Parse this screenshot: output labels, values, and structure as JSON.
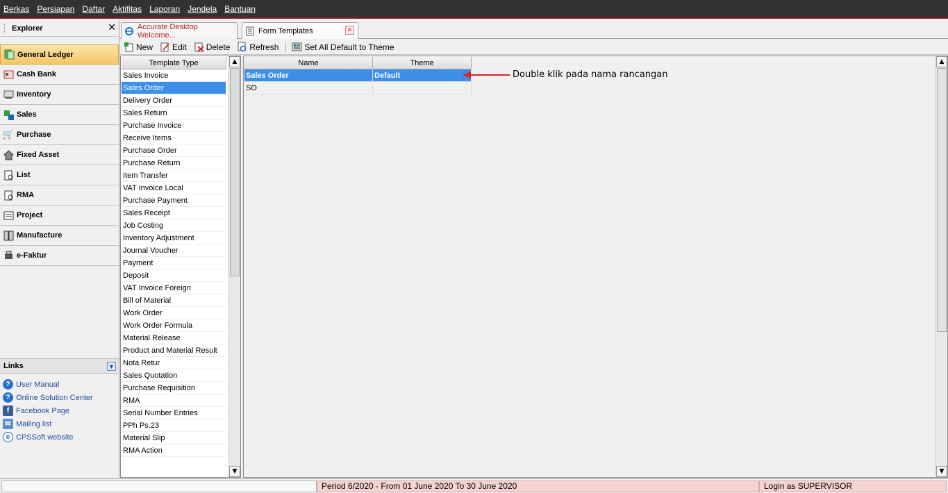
{
  "menu": [
    "Berkas",
    "Persiapan",
    "Daftar",
    "Aktifitas",
    "Laporan",
    "Jendela",
    "Bantuan"
  ],
  "explorer": {
    "title": "Explorer",
    "modules": [
      {
        "label": "General Ledger",
        "icon": "ledger-icon",
        "active": true
      },
      {
        "label": "Cash Bank",
        "icon": "cash-bank-icon"
      },
      {
        "label": "Inventory",
        "icon": "inventory-icon"
      },
      {
        "label": "Sales",
        "icon": "sales-icon"
      },
      {
        "label": "Purchase",
        "icon": "purchase-cart-icon"
      },
      {
        "label": "Fixed Asset",
        "icon": "house-icon"
      },
      {
        "label": "List",
        "icon": "list-icon"
      },
      {
        "label": "RMA",
        "icon": "rma-icon"
      },
      {
        "label": "Project",
        "icon": "project-icon"
      },
      {
        "label": "Manufacture",
        "icon": "manufacture-icon"
      },
      {
        "label": "e-Faktur",
        "icon": "printer-icon"
      }
    ],
    "links_title": "Links",
    "links": [
      {
        "label": "User Manual",
        "icon": "help-icon"
      },
      {
        "label": "Online Solution Center",
        "icon": "help-icon"
      },
      {
        "label": "Facebook Page",
        "icon": "facebook-icon"
      },
      {
        "label": "Mailing list",
        "icon": "mailing-list-icon"
      },
      {
        "label": "CPSSoft website",
        "icon": "ie-icon"
      }
    ]
  },
  "tabs": [
    {
      "label": "Accurate Desktop Welcome..."
    },
    {
      "label": "Form Templates"
    }
  ],
  "toolbar": {
    "new_label": "New",
    "edit_label": "Edit",
    "delete_label": "Delete",
    "refresh_label": "Refresh",
    "set_default_label": "Set All Default to Theme"
  },
  "template_type": {
    "header": "Template Type",
    "selected_index": 1,
    "items": [
      "Sales Invoice",
      "Sales Order",
      "Delivery Order",
      "Sales Return",
      "Purchase Invoice",
      "Receive Items",
      "Purchase Order",
      "Purchase Return",
      "Item Transfer",
      "VAT Invoice Local",
      "Purchase Payment",
      "Sales Receipt",
      "Job Costing",
      "Inventory Adjustment",
      "Journal Voucher",
      "Payment",
      "Deposit",
      "VAT Invoice Foreign",
      "Bill of Material",
      "Work Order",
      "Work Order Formula",
      "Material Release",
      "Product and Material Result",
      "Nota Retur",
      "Sales Quotation",
      "Purchase Requisition",
      "RMA",
      "Serial Number Entries",
      "PPh Ps.23",
      "Material Slip",
      "RMA Action"
    ]
  },
  "grid": {
    "columns": [
      "Name",
      "Theme"
    ],
    "rows": [
      {
        "name": "Sales Order",
        "theme": "Default",
        "selected": true
      },
      {
        "name": "SO",
        "theme": ""
      }
    ]
  },
  "annotation": "Double klik pada nama rancangan",
  "status": {
    "period": "Period 6/2020 - From 01 June 2020 To 30 June 2020",
    "login": "Login as SUPERVISOR"
  },
  "colors": {
    "selection": "#3d8ee6",
    "arrow": "#e02020",
    "menubar": "#323232",
    "status_bg": "#f6d2d2"
  }
}
